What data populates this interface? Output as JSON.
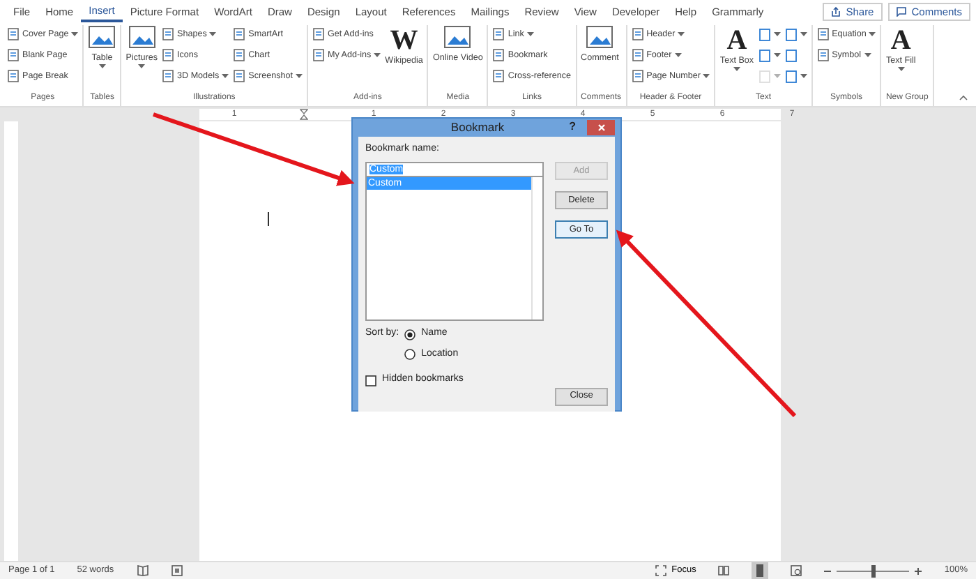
{
  "tabs": [
    {
      "label": "File",
      "selected": false
    },
    {
      "label": "Home",
      "selected": false
    },
    {
      "label": "Insert",
      "selected": true
    },
    {
      "label": "Picture Format",
      "selected": false
    },
    {
      "label": "WordArt",
      "selected": false
    },
    {
      "label": "Draw",
      "selected": false
    },
    {
      "label": "Design",
      "selected": false
    },
    {
      "label": "Layout",
      "selected": false
    },
    {
      "label": "References",
      "selected": false
    },
    {
      "label": "Mailings",
      "selected": false
    },
    {
      "label": "Review",
      "selected": false
    },
    {
      "label": "View",
      "selected": false
    },
    {
      "label": "Developer",
      "selected": false
    },
    {
      "label": "Help",
      "selected": false
    },
    {
      "label": "Grammarly",
      "selected": false
    }
  ],
  "share": "Share",
  "comments": "Comments",
  "ribbon": [
    {
      "label": "Pages",
      "columns": [
        [
          {
            "kind": "small",
            "label": "Cover Page",
            "dropdown": true
          },
          {
            "kind": "small",
            "label": "Blank Page",
            "dropdown": false
          },
          {
            "kind": "small",
            "label": "Page Break",
            "dropdown": false
          }
        ]
      ]
    },
    {
      "label": "Tables",
      "columns": [
        [
          {
            "kind": "large",
            "label": "Table",
            "dropdown": true
          }
        ]
      ]
    },
    {
      "label": "Illustrations",
      "columns": [
        [
          {
            "kind": "large",
            "label": "Pictures",
            "dropdown": true
          }
        ],
        [
          {
            "kind": "small",
            "label": "Shapes",
            "dropdown": true
          },
          {
            "kind": "small",
            "label": "Icons",
            "dropdown": false
          },
          {
            "kind": "small",
            "label": "3D Models",
            "dropdown": true
          }
        ],
        [
          {
            "kind": "small",
            "label": "SmartArt",
            "dropdown": false
          },
          {
            "kind": "small",
            "label": "Chart",
            "dropdown": false
          },
          {
            "kind": "small",
            "label": "Screenshot",
            "dropdown": true
          }
        ]
      ]
    },
    {
      "label": "Add-ins",
      "columns": [
        [
          {
            "kind": "small",
            "label": "Get Add-ins",
            "dropdown": false
          },
          {
            "kind": "small",
            "label": "My Add-ins",
            "dropdown": true
          }
        ],
        [
          {
            "kind": "glyph",
            "glyph": "W",
            "label": "Wikipedia",
            "dropdown": false
          }
        ]
      ]
    },
    {
      "label": "Media",
      "columns": [
        [
          {
            "kind": "large",
            "label": "Online Video",
            "dropdown": false
          }
        ]
      ]
    },
    {
      "label": "Links",
      "columns": [
        [
          {
            "kind": "small",
            "label": "Link",
            "dropdown": true
          },
          {
            "kind": "small",
            "label": "Bookmark",
            "dropdown": false
          },
          {
            "kind": "small",
            "label": "Cross-reference",
            "dropdown": false
          }
        ]
      ]
    },
    {
      "label": "Comments",
      "columns": [
        [
          {
            "kind": "large",
            "label": "Comment",
            "dropdown": false
          }
        ]
      ]
    },
    {
      "label": "Header & Footer",
      "columns": [
        [
          {
            "kind": "small",
            "label": "Header",
            "dropdown": true
          },
          {
            "kind": "small",
            "label": "Footer",
            "dropdown": true
          },
          {
            "kind": "small",
            "label": "Page Number",
            "dropdown": true
          }
        ]
      ]
    },
    {
      "label": "Text",
      "columns": [
        [
          {
            "kind": "glyph",
            "glyph": "A",
            "label": "Text Box",
            "dropdown": true
          }
        ],
        [
          {
            "kind": "icon",
            "dropdown": true,
            "disabled": false
          },
          {
            "kind": "icon",
            "dropdown": true,
            "disabled": false
          },
          {
            "kind": "icon",
            "dropdown": true,
            "disabled": true
          }
        ],
        [
          {
            "kind": "icon",
            "dropdown": true,
            "disabled": false
          },
          {
            "kind": "icon",
            "dropdown": false,
            "disabled": false
          },
          {
            "kind": "icon",
            "dropdown": true,
            "disabled": false
          }
        ]
      ]
    },
    {
      "label": "Symbols",
      "columns": [
        [
          {
            "kind": "small",
            "label": "Equation",
            "dropdown": true
          },
          {
            "kind": "small",
            "label": "Symbol",
            "dropdown": true
          }
        ]
      ]
    },
    {
      "label": "New Group",
      "columns": [
        [
          {
            "kind": "glyph",
            "glyph": "A",
            "label": "Text Fill",
            "dropdown": true
          }
        ]
      ]
    }
  ],
  "ruler": [
    "1",
    "1",
    "2",
    "3",
    "4",
    "5",
    "6",
    "7"
  ],
  "dialog": {
    "title": "Bookmark",
    "help": "?",
    "name_label": "Bookmark name:",
    "name_value": "Custom",
    "list": [
      {
        "label": "Custom",
        "selected": true
      }
    ],
    "buttons": [
      {
        "label": "Add",
        "disabled": true,
        "focused": false
      },
      {
        "label": "Delete",
        "disabled": false,
        "focused": false
      },
      {
        "label": "Go To",
        "disabled": false,
        "focused": true
      }
    ],
    "sort_label": "Sort by:",
    "sort": [
      {
        "label": "Name",
        "selected": true
      },
      {
        "label": "Location",
        "selected": false
      }
    ],
    "hidden": {
      "label": "Hidden bookmarks",
      "checked": false
    },
    "close": "Close"
  },
  "status": {
    "page": "Page 1 of 1",
    "words": "52 words",
    "focus": "Focus",
    "zoom_slider": {
      "level": 0.5
    },
    "zoom": "100%"
  }
}
